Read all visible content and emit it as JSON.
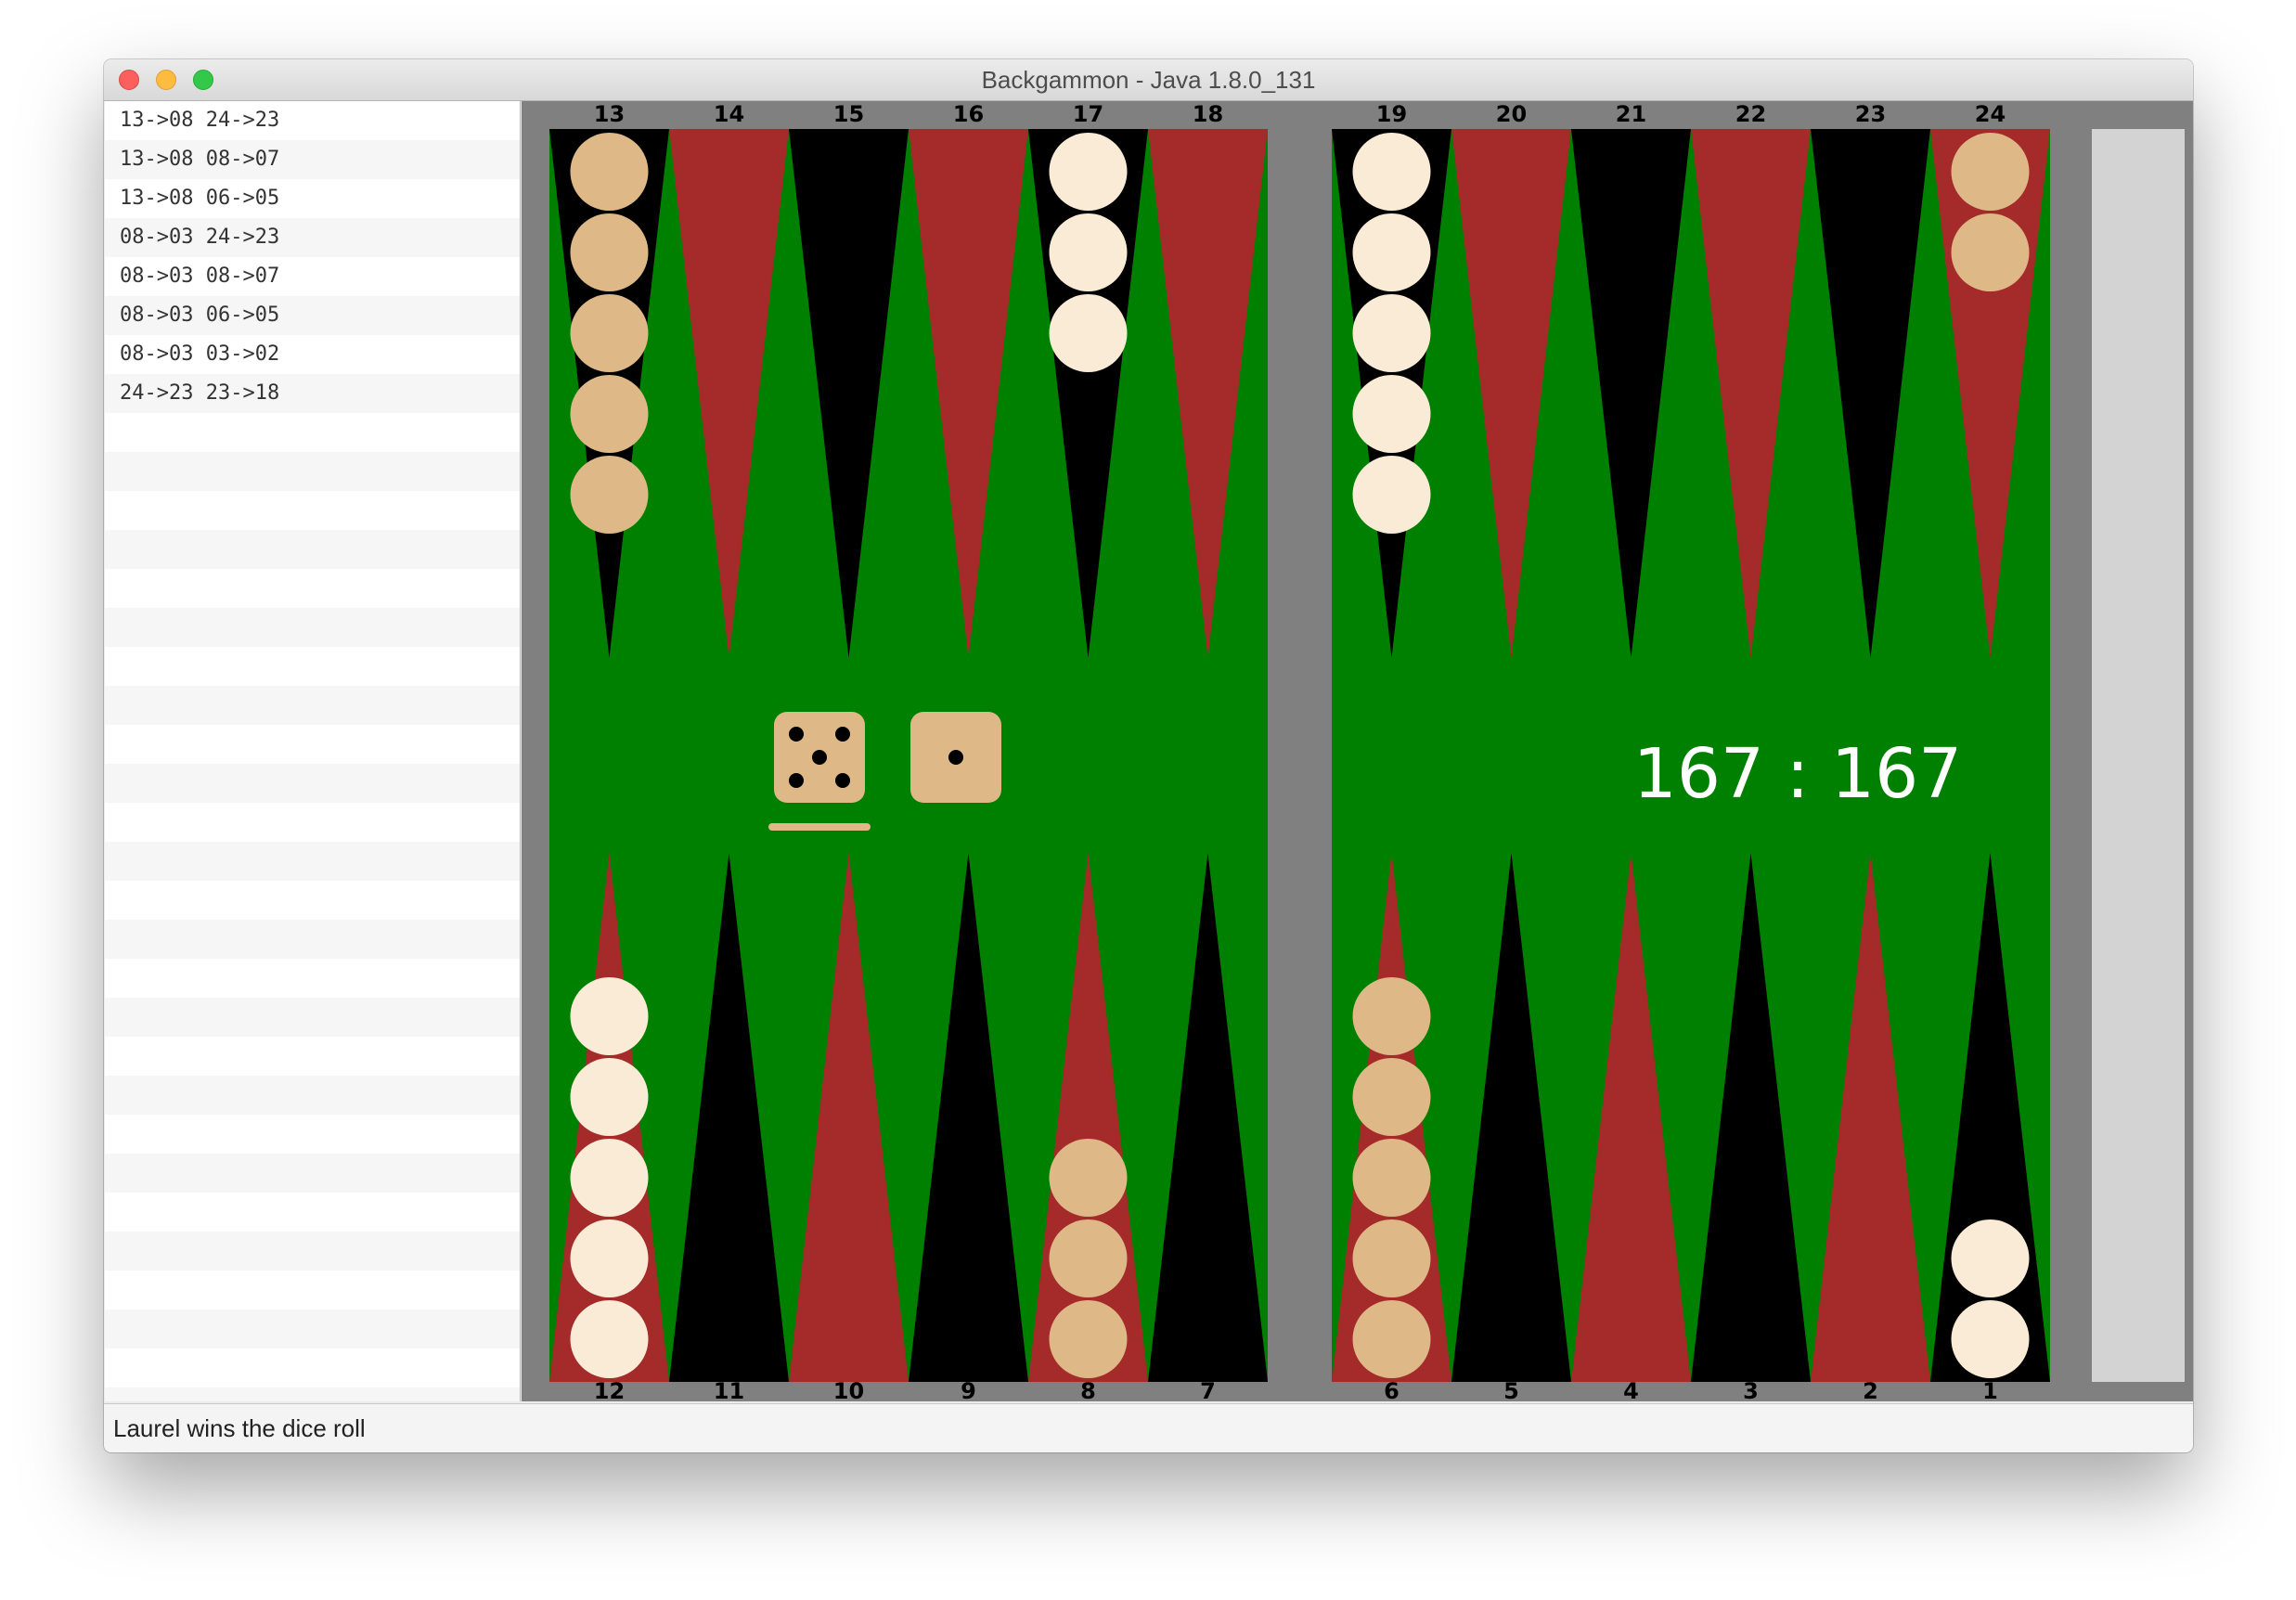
{
  "window": {
    "title": "Backgammon - Java 1.8.0_131"
  },
  "moves": [
    "13->08 24->23",
    "13->08 08->07",
    "13->08 06->05",
    "08->03 24->23",
    "08->03 08->07",
    "08->03 06->05",
    "08->03 03->02",
    "24->23 23->18"
  ],
  "status": "Laurel wins the dice roll",
  "board": {
    "top_points": [
      13,
      14,
      15,
      16,
      17,
      18,
      19,
      20,
      21,
      22,
      23,
      24
    ],
    "bottom_points": [
      12,
      11,
      10,
      9,
      8,
      7,
      6,
      5,
      4,
      3,
      2,
      1
    ],
    "score": "167 : 167",
    "dice": [
      5,
      1
    ],
    "active_die": 0,
    "checkers": [
      {
        "point": 13,
        "color": "tan",
        "count": 5
      },
      {
        "point": 17,
        "color": "cream",
        "count": 3
      },
      {
        "point": 19,
        "color": "cream",
        "count": 5
      },
      {
        "point": 24,
        "color": "tan",
        "count": 2
      },
      {
        "point": 12,
        "color": "cream",
        "count": 5
      },
      {
        "point": 8,
        "color": "tan",
        "count": 3
      },
      {
        "point": 6,
        "color": "tan",
        "count": 5
      },
      {
        "point": 1,
        "color": "cream",
        "count": 2
      }
    ],
    "colors": {
      "felt": "#008000",
      "frame": "#808080",
      "red_point": "#a52a2a",
      "black_point": "#000000",
      "tan_checker": "#deb887",
      "cream_checker": "#faebd7",
      "bear_off": "#d3d3d3"
    }
  }
}
